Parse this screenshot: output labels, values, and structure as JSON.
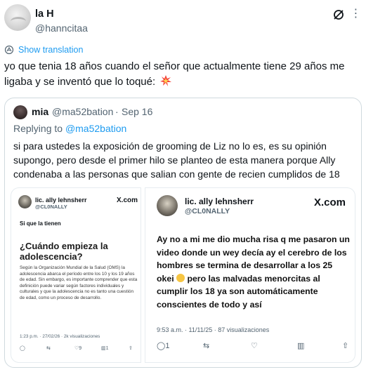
{
  "post": {
    "author_name": "la H",
    "author_handle": "@hanncitaa",
    "translate_label": "Show translation",
    "text": "yo que tenia 18 años cuando el señor que actualmente tiene 29 años me ligaba y se inventó que lo toqué:"
  },
  "quote": {
    "author_name": "mia",
    "author_handle": "@ma52bation",
    "dot": "·",
    "date": "Sep 16",
    "reply_prefix": "Replying to ",
    "reply_handle": "@ma52bation",
    "text": "si para ustedes la exposición de grooming de Liz no lo es, es su opinión supongo, pero desde el primer hilo se planteo de esta manera porque Ally condenaba a las personas que salian con gente de recien cumplidos de 18"
  },
  "image_left": {
    "name": "lic. ally lehnsherr",
    "handle": "@CL0NALLY",
    "logo": "X.com",
    "line1": "Si que la tienen",
    "heading": "¿Cuándo empieza la adolescencia?",
    "body": "Según la Organización Mundial de la Salud (OMS) la adolescencia abarca el período entre los 10 y los 19 años de edad. Sin embargo, es importante comprender que esta definición puede variar según factores individuales y culturales y que la adolescencia no es tanto una cuestión de edad, como un proceso de desarrollo.",
    "meta": "1:23 p.m. · 27/02/26 · 2k visualizaciones",
    "actions": [
      "",
      "",
      "9",
      "1",
      ""
    ]
  },
  "image_right": {
    "name": "lic. ally lehnsherr",
    "handle": "@CL0NALLY",
    "logo": "X.com",
    "body_before": "Ay no a mi me dio mucha risa q me pasaron un video donde un wey decía ay el cerebro de los hombres se termina de desarrollar a los 25 okei",
    "body_after": "pero las malvadas menorcitas al cumplir los 18 ya son automáticamente conscientes de todo y así",
    "meta": "9:53 a.m. · 11/11/25 · 87 visualizaciones",
    "actions": [
      "1",
      "",
      "",
      "",
      ""
    ]
  },
  "icons": {
    "grok": "grok-icon",
    "more": "more-icon",
    "translate": "globe-icon",
    "boom": "collision-emoji-icon"
  },
  "colors": {
    "link": "#1d9bf0",
    "muted": "#536471",
    "border": "#cfd9de"
  }
}
